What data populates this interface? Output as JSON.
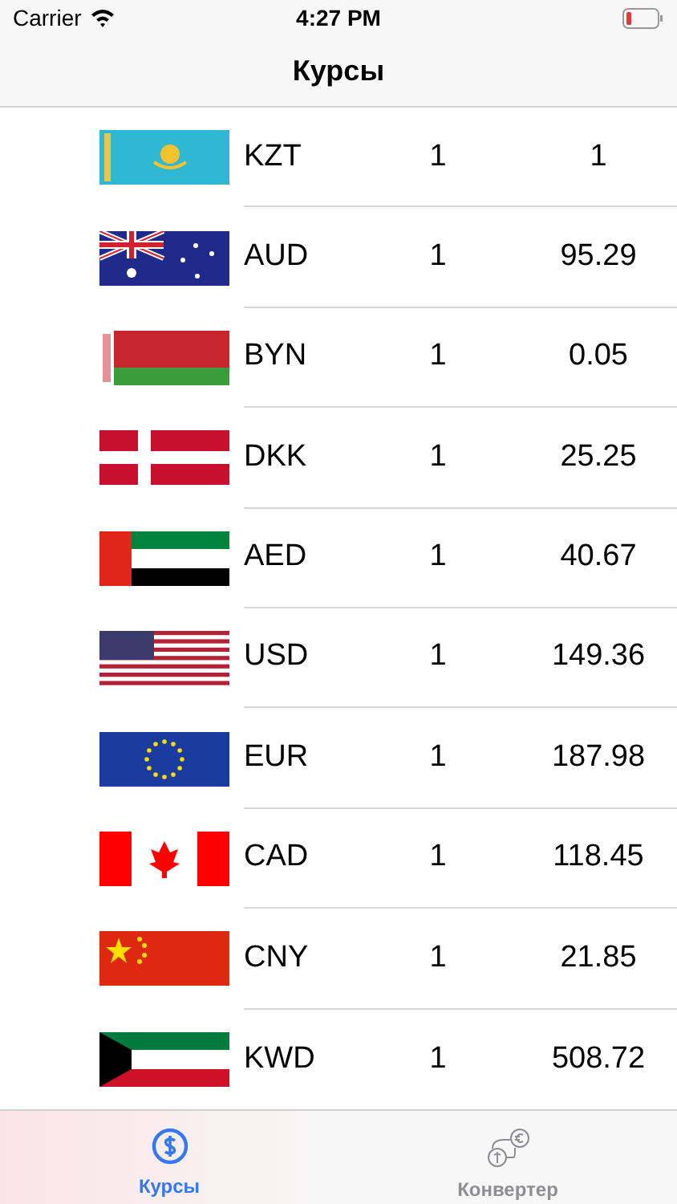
{
  "status_bar": {
    "carrier": "Carrier",
    "time": "4:27 PM"
  },
  "nav": {
    "title": "Курсы"
  },
  "rates": [
    {
      "code": "KZT",
      "amount": "1",
      "rate": "1"
    },
    {
      "code": "AUD",
      "amount": "1",
      "rate": "95.29"
    },
    {
      "code": "BYN",
      "amount": "1",
      "rate": "0.05"
    },
    {
      "code": "DKK",
      "amount": "1",
      "rate": "25.25"
    },
    {
      "code": "AED",
      "amount": "1",
      "rate": "40.67"
    },
    {
      "code": "USD",
      "amount": "1",
      "rate": "149.36"
    },
    {
      "code": "EUR",
      "amount": "1",
      "rate": "187.98"
    },
    {
      "code": "CAD",
      "amount": "1",
      "rate": "118.45"
    },
    {
      "code": "CNY",
      "amount": "1",
      "rate": "21.85"
    },
    {
      "code": "KWD",
      "amount": "1",
      "rate": "508.72"
    }
  ],
  "tabs": [
    {
      "label": "Курсы",
      "selected": true
    },
    {
      "label": "Конвертер",
      "selected": false
    }
  ]
}
